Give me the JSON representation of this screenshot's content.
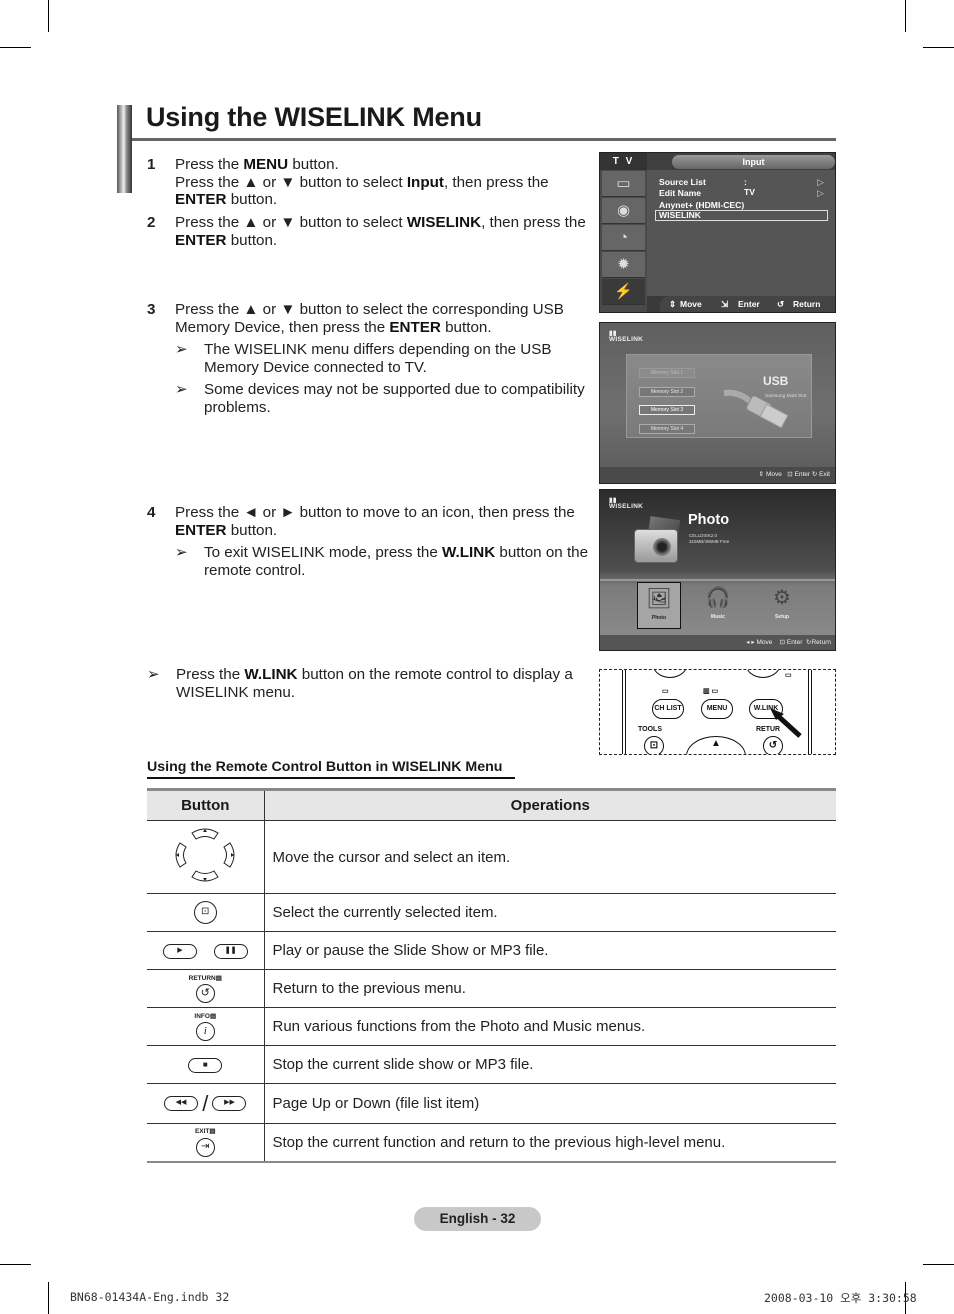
{
  "header": {
    "title": "Using the WISELINK Menu"
  },
  "steps": [
    {
      "num": "1",
      "lines": [
        {
          "t": [
            "Press the ",
            "MENU",
            " button."
          ]
        },
        {
          "t": [
            "Press the ▲ or ▼ button to select ",
            "Input",
            ", then press the ",
            "ENTER",
            " button."
          ]
        }
      ]
    },
    {
      "num": "2",
      "lines": [
        {
          "t": [
            "Press the ▲ or ▼ button to select ",
            "WISELINK",
            ", then press the ",
            "ENTER",
            " button."
          ]
        }
      ]
    },
    {
      "num": "3",
      "lines": [
        {
          "t": [
            "Press the ▲ or ▼ button to select the corresponding USB Memory Device, then press the ",
            "ENTER",
            " button."
          ]
        }
      ],
      "notes": [
        "The WISELINK menu differs depending on the USB Memory Device connected to TV.",
        "Some devices may not be supported due to compatibility problems."
      ]
    },
    {
      "num": "4",
      "lines": [
        {
          "t": [
            "Press the ◄ or ► button to move to an icon, then press the ",
            "ENTER",
            " button."
          ]
        }
      ],
      "notes_rich": [
        {
          "t": [
            "To exit WISELINK mode, press the ",
            "W.LINK",
            " button on the remote control."
          ]
        }
      ]
    }
  ],
  "standalone_note": {
    "t": [
      "Press the ",
      "W.LINK",
      " button on the remote control to display a WISELINK menu."
    ]
  },
  "note_arrow": "➢",
  "screen_input": {
    "side_label": "T V",
    "title": "Input",
    "side_icons": [
      "picture-icon",
      "sound-icon",
      "channel-icon",
      "setup-icon",
      "input-icon"
    ],
    "rows": [
      {
        "label": "Source List",
        "value": ": TV",
        "arrow": "▷"
      },
      {
        "label": "Edit Name",
        "value": "",
        "arrow": "▷"
      },
      {
        "label": "Anynet+ (HDMI-CEC)",
        "value": "",
        "arrow": ""
      },
      {
        "label": "WISELINK",
        "value": "",
        "arrow": "",
        "selected": true
      }
    ],
    "footer": {
      "move": "Move",
      "enter": "Enter",
      "return": "Return"
    }
  },
  "screen_usb": {
    "logo_top": "▮▮",
    "logo": "WISELINK",
    "slots": [
      {
        "label": "Memory Slot 1",
        "state": "disabled"
      },
      {
        "label": "Memory Slot 2",
        "state": "normal"
      },
      {
        "label": "Memory Slot 3",
        "state": "selected"
      },
      {
        "label": "Memory Slot 4",
        "state": "normal"
      }
    ],
    "device_title": "USB",
    "device_sub": "Samsung Multi Slot",
    "footer": {
      "move": "Move",
      "enter": "Enter",
      "exit": "Exit"
    }
  },
  "screen_photo": {
    "logo_top": "▮▮",
    "logo": "WISELINK",
    "title": "Photo",
    "info_line1": "CELLDISK2.0",
    "info_line2": "315MB/495MB Free",
    "tiles": [
      {
        "label": "Photo",
        "selected": true
      },
      {
        "label": "Music",
        "selected": false
      },
      {
        "label": "Setup",
        "selected": false
      }
    ],
    "footer": {
      "move": "Move",
      "enter": "Enter",
      "return": "Return"
    }
  },
  "remote": {
    "ch_list": "CH LIST",
    "menu": "MENU",
    "wlink": "W.LINK",
    "tools": "TOOLS",
    "return": "RETUR"
  },
  "subheading": "Using the Remote Control Button in WISELINK Menu",
  "table": {
    "headers": [
      "Button",
      "Operations"
    ],
    "rows": [
      {
        "button": "navigation-pad",
        "op": "Move the cursor and select an item."
      },
      {
        "button": "enter",
        "op": "Select the currently selected item."
      },
      {
        "button": "play-pause",
        "op": "Play or pause the Slide Show or MP3 file."
      },
      {
        "button": "return",
        "label": "RETURN",
        "op": "Return to the previous menu."
      },
      {
        "button": "info",
        "label": "INFO",
        "op": "Run various functions from the Photo and Music menus."
      },
      {
        "button": "stop",
        "op": "Stop the current slide show or MP3 file."
      },
      {
        "button": "rewind-fastforward",
        "op": "Page Up or Down (file list item)"
      },
      {
        "button": "exit",
        "label": "EXIT",
        "op": "Stop the current function and return to the previous high-level menu."
      }
    ]
  },
  "footer": {
    "page": "English - 32",
    "file": "BN68-01434A-Eng.indb   32",
    "timestamp": "2008-03-10   오후 3:30:58"
  }
}
